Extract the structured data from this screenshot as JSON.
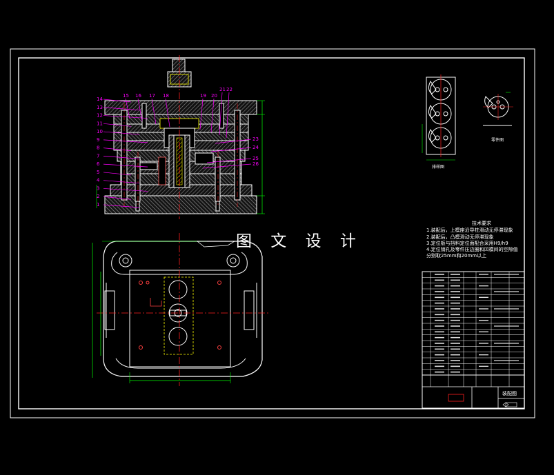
{
  "watermark": "图 文 设 计",
  "technical_requirements": {
    "title": "技术要求",
    "items": [
      "1.装配后，上模座沿导柱滑动无停滞现象",
      "2.装配后，凸模滑动无停滞现象",
      "3.定位板与挡料定位面配合采用H9/h9",
      "4.定位销孔及零件压边圈和凹模间的空隙值",
      "  分别取25mm和20mm以上"
    ]
  },
  "view_labels": {
    "strip_layout": "排样图",
    "part_drawing": "零件图"
  },
  "title_block": {
    "drawing_title": "装配图"
  },
  "part_numbers_left": [
    "14",
    "13",
    "12",
    "11",
    "10",
    "9",
    "8",
    "7",
    "6",
    "5",
    "4",
    "3",
    "2",
    "1"
  ],
  "part_numbers_top": [
    "15",
    "16",
    "17",
    "18",
    "19",
    "20",
    "21",
    "22"
  ],
  "part_numbers_right": [
    "23",
    "24",
    "25",
    "26"
  ],
  "colors": {
    "background": "#000000",
    "frame": "#ffffff",
    "section": "#9c9c9c",
    "outline": "#ffffff",
    "centerline": "#ff2020",
    "leader": "#ff00ff",
    "hidden": "#ffff00",
    "dimension": "#00ff00"
  }
}
